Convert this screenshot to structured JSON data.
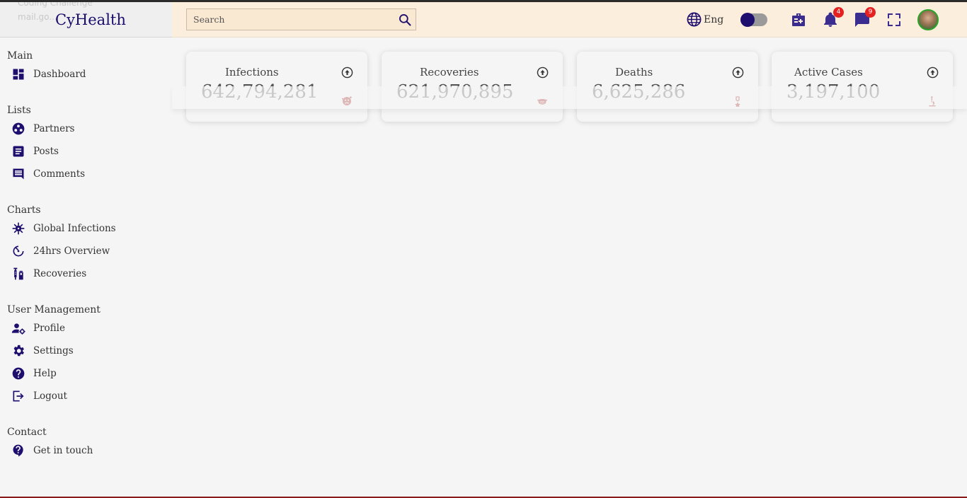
{
  "app": {
    "name": "CyHealth",
    "ghost_lines": [
      "Coding Challenge",
      "mail.go..."
    ]
  },
  "header": {
    "search_placeholder": "Search",
    "language": "Eng",
    "notifications_count": "4",
    "messages_count": "9"
  },
  "sidebar": {
    "sections": [
      {
        "title": "Main",
        "items": [
          {
            "label": "Dashboard",
            "icon": "dashboard-icon"
          }
        ]
      },
      {
        "title": "Lists",
        "items": [
          {
            "label": "Partners",
            "icon": "partners-icon"
          },
          {
            "label": "Posts",
            "icon": "posts-icon"
          },
          {
            "label": "Comments",
            "icon": "comments-icon"
          }
        ]
      },
      {
        "title": "Charts",
        "items": [
          {
            "label": "Global Infections",
            "icon": "virus-icon"
          },
          {
            "label": "24hrs Overview",
            "icon": "timer-icon"
          },
          {
            "label": "Recoveries",
            "icon": "vaccine-icon"
          }
        ]
      },
      {
        "title": "User Management",
        "items": [
          {
            "label": "Profile",
            "icon": "profile-icon"
          },
          {
            "label": "Settings",
            "icon": "settings-icon"
          },
          {
            "label": "Help",
            "icon": "help-icon"
          },
          {
            "label": "Logout",
            "icon": "logout-icon"
          }
        ]
      },
      {
        "title": "Contact",
        "items": [
          {
            "label": "Get in touch",
            "icon": "contact-icon"
          }
        ]
      }
    ]
  },
  "cards": [
    {
      "title": "Infections",
      "value": "642,794,281",
      "icon": "sad-virus-icon"
    },
    {
      "title": "Recoveries",
      "value": "621,970,895",
      "icon": "mask-icon"
    },
    {
      "title": "Deaths",
      "value": "6,625,286",
      "icon": "medal-icon"
    },
    {
      "title": "Active Cases",
      "value": "3,197,100",
      "icon": "microscope-icon"
    }
  ],
  "colors": {
    "accent": "#1e0e6e",
    "header_bg": "#fbeedd",
    "badge": "#e52020",
    "card_icon": "#a01818"
  }
}
